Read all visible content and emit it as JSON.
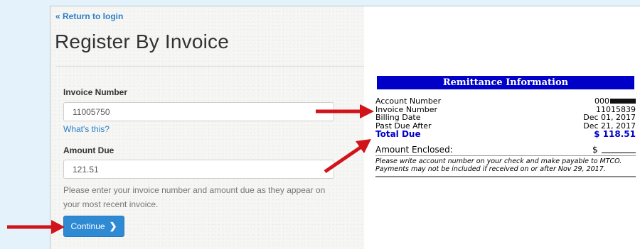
{
  "nav": {
    "return_label": "« Return to login"
  },
  "page": {
    "title": "Register By Invoice"
  },
  "form": {
    "invoice_label": "Invoice Number",
    "invoice_value": "11005750",
    "whats_this": "What's this?",
    "amount_label": "Amount Due",
    "amount_value": "121.51",
    "help_text": "Please enter your invoice number and amount due as they appear on your most recent invoice.",
    "continue_label": "Continue",
    "continue_icon": "chevron-right-icon"
  },
  "remittance": {
    "header": "Remittance Information",
    "rows": [
      {
        "label": "Account Number",
        "value": "000"
      },
      {
        "label": "Invoice Number",
        "value": "11015839"
      },
      {
        "label": "Billing Date",
        "value": "Dec 01, 2017"
      },
      {
        "label": "Past Due After",
        "value": "Dec 21, 2017"
      }
    ],
    "total_label": "Total Due",
    "total_value": "$ 118.51",
    "enclosed_label": "Amount Enclosed:",
    "enclosed_currency": "$",
    "note_line1": "Please write account number on your check and make payable to MTCO.",
    "note_line2": "Payments may not be included if received on or after Nov 29, 2017."
  },
  "colors": {
    "background": "#e4f3fb",
    "link": "#2a7fc8",
    "button": "#2f8ad4",
    "remit_header": "#0000c8",
    "arrow": "#d0141a"
  }
}
